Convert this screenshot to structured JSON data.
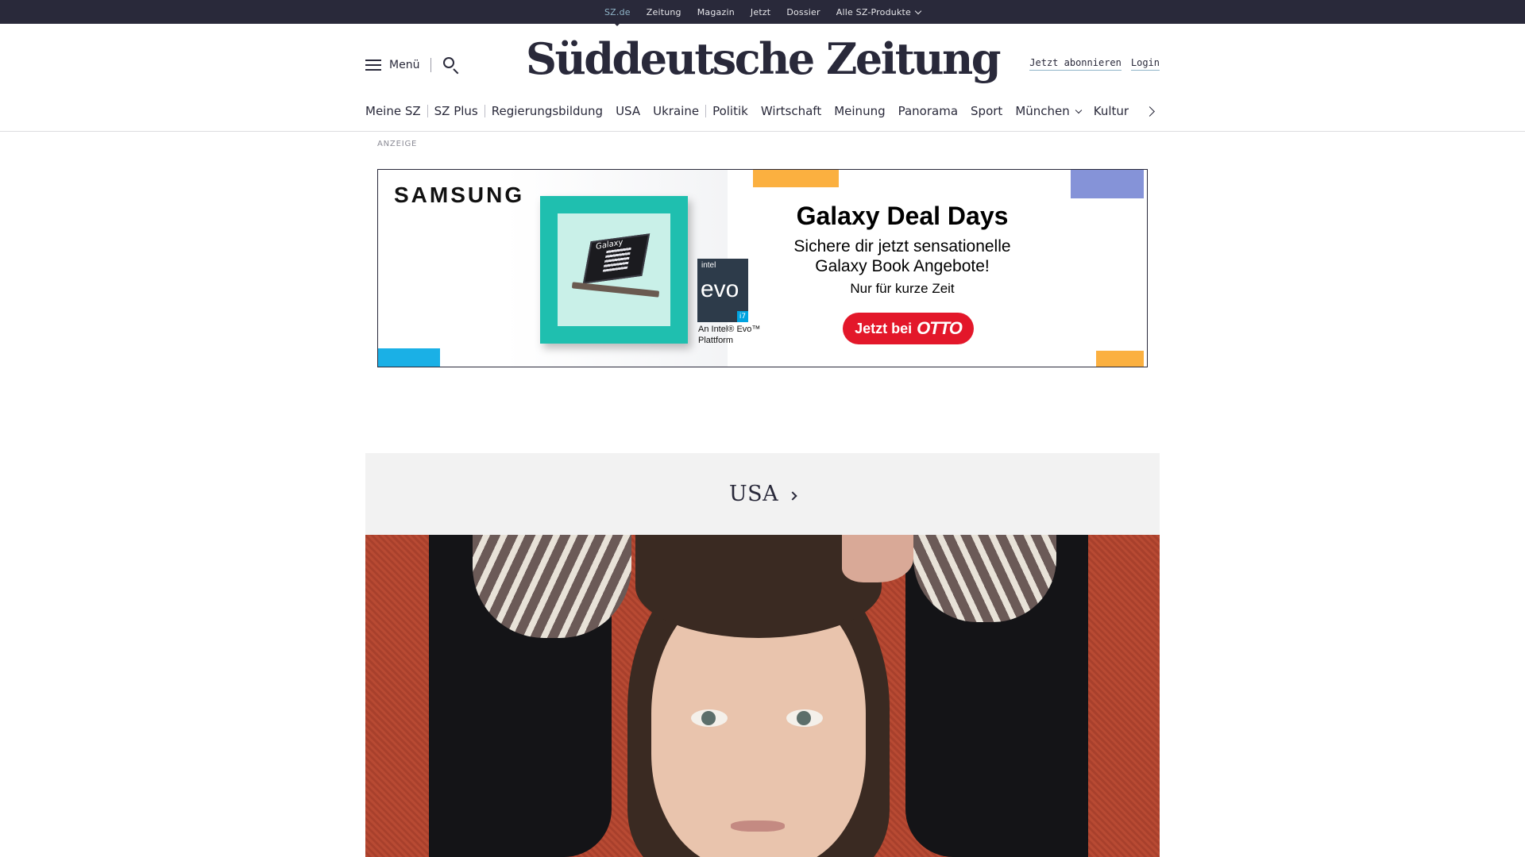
{
  "topbar": {
    "items": [
      "SZ.de",
      "Zeitung",
      "Magazin",
      "Jetzt",
      "Dossier",
      "Alle SZ-Produkte"
    ],
    "active": "SZ.de"
  },
  "header": {
    "menu_label": "Menü",
    "logo_text": "Süddeutsche Zeitung",
    "subscribe_label": "Jetzt abonnieren",
    "login_label": "Login"
  },
  "nav": {
    "items": [
      "Meine SZ",
      "SZ Plus",
      "Regierungsbildung",
      "USA",
      "Ukraine",
      "Politik",
      "Wirtschaft",
      "Meinung",
      "Panorama",
      "Sport",
      "München",
      "Kultur"
    ]
  },
  "ad": {
    "label": "ANZEIGE",
    "brand": "SAMSUNG",
    "product_word": "Galaxy",
    "intel_label": "intel",
    "evo_label": "evo",
    "evo_tier": "i7",
    "evo_caption": "An Intel® Evo™ Plattform",
    "title": "Galaxy Deal Days",
    "subtitle": "Sichere dir jetzt sensationelle Galaxy Book Angebote!",
    "note": "Nur für kurze Zeit",
    "cta_prefix": "Jetzt bei",
    "cta_brand": "OTTO",
    "colors": {
      "teal": "#1fbfaf",
      "orange": "#fbb040",
      "periwinkle": "#8593d8",
      "cyan": "#1ab0e6",
      "cta_red": "#e3172a"
    }
  },
  "section": {
    "title": "USA"
  },
  "colors": {
    "topbar_bg": "#29293a",
    "text": "#29293a",
    "active_link": "#8fb4c8",
    "section_bg": "#f2f2f2"
  }
}
